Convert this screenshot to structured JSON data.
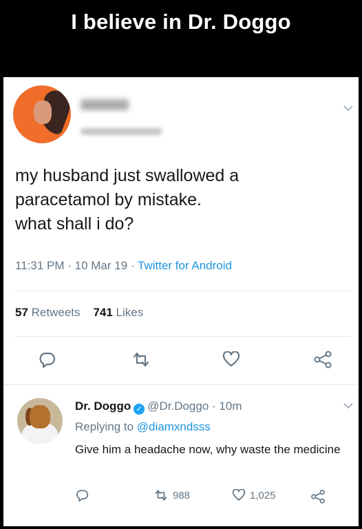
{
  "banner": {
    "title": "I believe in Dr. Doggo"
  },
  "tweet": {
    "text_lines": [
      "my husband just swallowed a",
      "paracetamol by mistake.",
      "what shall i do?"
    ],
    "time": "11:31 PM",
    "date": "10 Mar 19",
    "app": "Twitter for Android",
    "retweets_count": "57",
    "retweets_label": "Retweets",
    "likes_count": "741",
    "likes_label": "Likes"
  },
  "reply": {
    "name": "Dr. Doggo",
    "handle": "@Dr.Doggo",
    "time": "10m",
    "replying_label": "Replying to",
    "replying_to": "@diamxndsss",
    "text": "Give him a headache now, why waste the medicine",
    "retweets": "988",
    "likes": "1,025"
  },
  "colors": {
    "link": "#1b95e0",
    "secondary": "#657786",
    "verified": "#1da1f2"
  },
  "icons": [
    "reply-icon",
    "retweet-icon",
    "like-icon",
    "share-icon",
    "chevron-down-icon",
    "verified-badge-icon"
  ]
}
